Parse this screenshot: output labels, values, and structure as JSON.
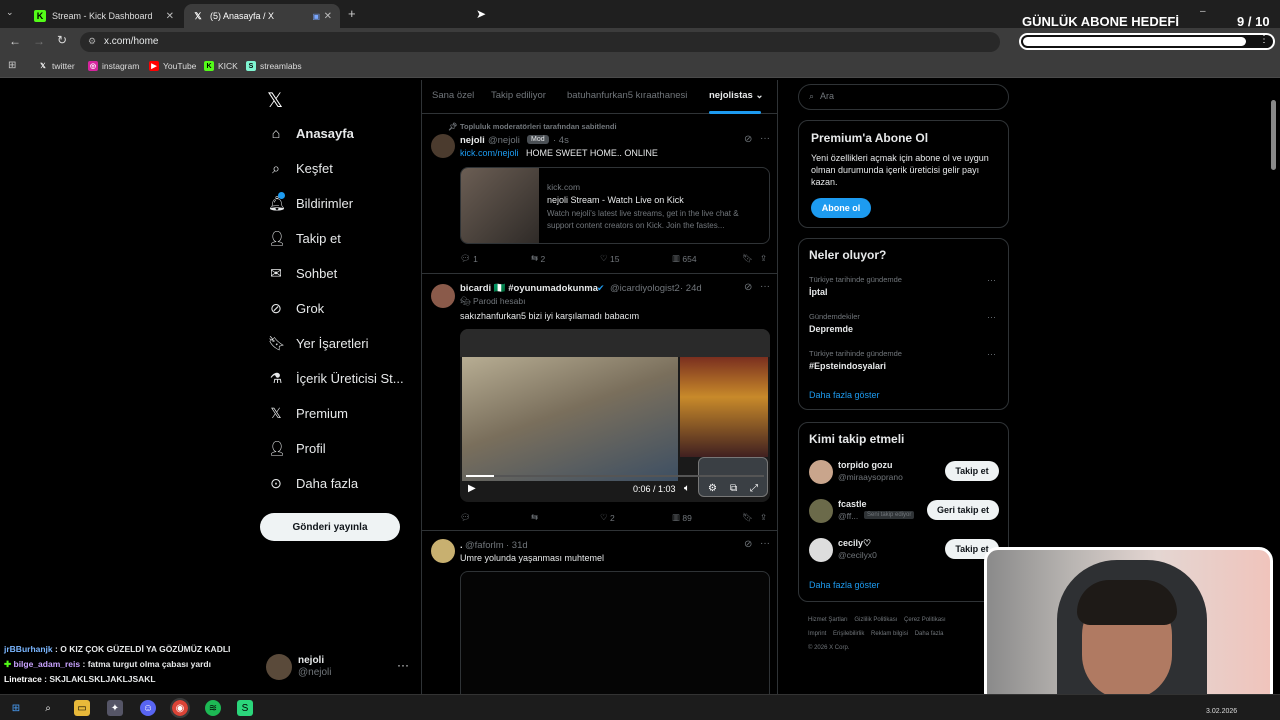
{
  "browser": {
    "tabs": [
      {
        "label": "Stream - Kick Dashboard",
        "icon": "kick-icon"
      },
      {
        "label": "(5) Anasayfa / X",
        "icon": "x-icon"
      }
    ],
    "address": "x.com/home",
    "bookmarks": [
      "twitter",
      "instagram",
      "YouTube",
      "KICK",
      "streamlabs"
    ]
  },
  "overlay": {
    "goal_title": "GÜNLÜK ABONE HEDEFİ",
    "goal_count": "9",
    "goal_total": "/ 10",
    "goal_progress": 0.9
  },
  "nav": {
    "items": [
      "Anasayfa",
      "Keşfet",
      "Bildirimler",
      "Takip et",
      "Sohbet",
      "Grok",
      "Yer İşaretleri",
      "İçerik Üreticisi St...",
      "Premium",
      "Profil",
      "Daha fazla"
    ],
    "post_button": "Gönderi yayınla",
    "user_name": "nejoli",
    "user_handle": "@nejoli"
  },
  "feed": {
    "tabs": [
      "Sana özel",
      "Takip ediliyor",
      "batuhanfurkan5 kıraathanesi",
      "nejolistas"
    ],
    "tweet1": {
      "pinned": "Topluluk moderatörleri tarafından sabitlendi",
      "name": "nejoli",
      "handle": "@nejoli",
      "badge": "Mod",
      "time": "· 4s",
      "link": "kick.com/nejoli",
      "text": "HOME SWEET HOME.. ONLINE",
      "card_domain": "kick.com",
      "card_title": "nejoli Stream - Watch Live on Kick",
      "card_desc": "Watch nejoli's latest live streams, get in the live chat & support content creators on Kick. Join the fastes...",
      "replies": "1",
      "reposts": "2",
      "likes": "15",
      "views": "654"
    },
    "tweet2": {
      "name": "bicardi 🇳🇬 #oyunumadokunma",
      "handle": "@icardiyologist2",
      "time": "· 24d",
      "parody": "Parodi hesabı",
      "text": "sakızhanfurkan5 bizi iyi karşılamadı babacım",
      "video_time": "0:06 / 1:03",
      "likes": "2",
      "views": "89"
    },
    "tweet3": {
      "name": ".",
      "handle": "@faforlm",
      "time": "· 31d",
      "text": "Umre yolunda yaşanması muhtemel"
    }
  },
  "right": {
    "search_placeholder": "Ara",
    "premium": {
      "title": "Premium'a Abone Ol",
      "desc": "Yeni özellikleri açmak için abone ol ve uygun olman durumunda içerik üreticisi gelir payı kazan.",
      "button": "Abone ol"
    },
    "trends": {
      "title": "Neler oluyor?",
      "items": [
        {
          "context": "Türkiye tarihinde gündemde",
          "name": "İptal"
        },
        {
          "context": "Gündemdekiler",
          "name": "Depremde"
        },
        {
          "context": "Türkiye tarihinde gündemde",
          "name": "#Epsteindosyalari"
        }
      ],
      "more": "Daha fazla göster"
    },
    "follow": {
      "title": "Kimi takip etmeli",
      "items": [
        {
          "name": "torpido gozu",
          "handle": "@miraaysoprano",
          "button": "Takip et",
          "tag": ""
        },
        {
          "name": "fcastle",
          "handle": "@ff...",
          "button": "Geri takip et",
          "tag": "Seni takip ediyor"
        },
        {
          "name": "cecily♡",
          "handle": "@cecilyx0",
          "button": "Takip et",
          "tag": ""
        }
      ],
      "more": "Daha fazla göster"
    },
    "footer": [
      "Hizmet Şartları",
      "Gizlilik Politikası",
      "Çerez Politikası",
      "Imprint",
      "Erişilebilirlik",
      "Reklam bilgisi",
      "Daha fazla",
      "© 2026 X Corp."
    ]
  },
  "chat": [
    {
      "user": "jrBBurhanjk",
      "msg": ": O KIZ ÇOK GÜZELDİ YA GÖZÜMÜZ KADLI",
      "color": "#7ab6ff"
    },
    {
      "user": "bilge_adam_reis",
      "msg": ": fatma turgut olma çabası yardı",
      "color": "#c9a3ff"
    },
    {
      "user": "Linetrace",
      "msg": ": SKJLAKLSKLJAKLJSAKL",
      "color": "#ffffff"
    }
  ],
  "taskbar": {
    "date": "3.02.2026"
  },
  "colors": {
    "accent": "#1d9bf0",
    "kick": "#53fc18",
    "bg": "#000000",
    "border": "#2f3336"
  }
}
